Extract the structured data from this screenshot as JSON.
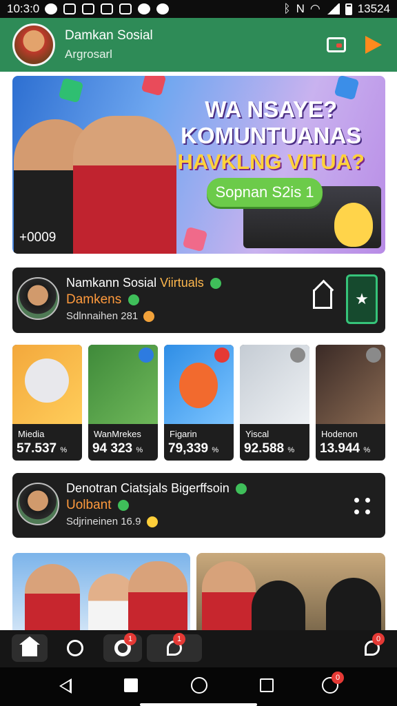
{
  "status_bar": {
    "time": "10:3:0",
    "battery_text": "13524",
    "icons": [
      "messenger-icon",
      "download-icon",
      "gallery-icon",
      "image-icon",
      "shield-icon",
      "settings-icon",
      "nfc-icon",
      "bluetooth-icon",
      "wifi-icon",
      "signal-icon",
      "battery-icon"
    ]
  },
  "header": {
    "app_title": "Damkan Sosial",
    "subtitle": "Argrosarl",
    "accent_color": "#2e8b57",
    "actions": [
      "wallet-icon",
      "play-icon"
    ]
  },
  "banner": {
    "headline_line1": "WA NSAYE?",
    "headline_line2": "KOMUNTUANAS",
    "headline_line3": "HAVKLNG VITUA?",
    "cta_label": "Sopnan S2is 1",
    "counter": "+0009"
  },
  "profile_card_1": {
    "name_primary": "Namkann Sosial",
    "name_accent": "Viirtuals",
    "sub": "Damkens",
    "meta": "Sdlnnaihen 281",
    "fav_icon": "star-icon",
    "share_icon": "share-icon"
  },
  "tiles": [
    {
      "label": "Miedia",
      "value": "57.537",
      "unit": "%",
      "colors": [
        "#f3a83c",
        "#ffcd5a"
      ]
    },
    {
      "label": "WanMrekes",
      "value": "94 323",
      "unit": "%",
      "colors": [
        "#3f8a3a",
        "#6fb85a"
      ]
    },
    {
      "label": "Figarin",
      "value": "79,339",
      "unit": "%",
      "colors": [
        "#2f8ee6",
        "#7cc4ff"
      ]
    },
    {
      "label": "Yiscal",
      "value": "92.588",
      "unit": "%",
      "colors": [
        "#c5ccd4",
        "#eef1f4"
      ]
    },
    {
      "label": "Hodenon",
      "value": "13.944",
      "unit": "%",
      "colors": [
        "#3a2a26",
        "#8a6a52"
      ]
    }
  ],
  "profile_card_2": {
    "name_primary": "Denotran Ciatsjals Bigerffsoin",
    "sub": "Uolbant",
    "meta": "Sdjrineinen 16.9"
  },
  "bottom_nav": {
    "items": [
      "home-icon",
      "shield-icon",
      "notifications-icon",
      "chat-icon",
      "messages-icon"
    ],
    "badge_3": "1",
    "badge_4": "1",
    "badge_5": "0"
  },
  "system_nav": {
    "badge": "0"
  }
}
